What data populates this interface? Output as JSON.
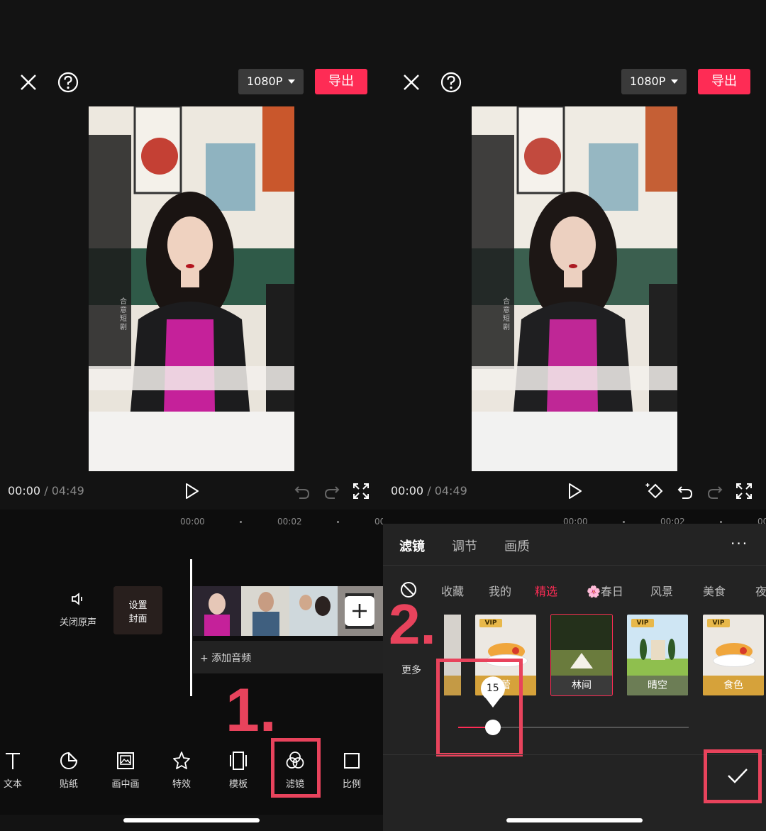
{
  "left": {
    "resolution": "1080P",
    "export": "导出",
    "time_current": "00:00",
    "time_sep": "/",
    "time_total": "04:49",
    "ruler": [
      "00:00",
      "00:02",
      "00"
    ],
    "mute_label": "关闭原声",
    "cover_line1": "设置",
    "cover_line2": "封面",
    "add_audio": "+ 添加音频",
    "step": "1.",
    "watermark": "合意短剧",
    "tools": [
      {
        "icon": "text-icon",
        "label": "文本"
      },
      {
        "icon": "sticker-icon",
        "label": "贴纸"
      },
      {
        "icon": "pip-icon",
        "label": "画中画"
      },
      {
        "icon": "effects-icon",
        "label": "特效"
      },
      {
        "icon": "template-icon",
        "label": "模板"
      },
      {
        "icon": "filter-icon",
        "label": "滤镜"
      },
      {
        "icon": "ratio-icon",
        "label": "比例"
      }
    ]
  },
  "right": {
    "resolution": "1080P",
    "export": "导出",
    "time_current": "00:00",
    "time_sep": "/",
    "time_total": "04:49",
    "ruler": [
      "00:00",
      "00:02",
      "00"
    ],
    "tabs": [
      "滤镜",
      "调节",
      "画质"
    ],
    "more": "···",
    "categories": [
      "收藏",
      "我的",
      "精选",
      "🌸春日",
      "风景",
      "美食",
      "夜"
    ],
    "active_category": "精选",
    "more_label": "更多",
    "filters": [
      {
        "label": "蕾",
        "vip": true
      },
      {
        "label": "林间",
        "vip": false,
        "selected": true
      },
      {
        "label": "晴空",
        "vip": true
      },
      {
        "label": "食色",
        "vip": true
      }
    ],
    "vip_badge": "VIP",
    "slider_value": "15",
    "slider_fraction": 0.15,
    "step": "2.",
    "watermark": "合意短剧"
  },
  "colors": {
    "accent": "#fe2c55",
    "annotation": "#e8435c",
    "background": "#131313"
  }
}
